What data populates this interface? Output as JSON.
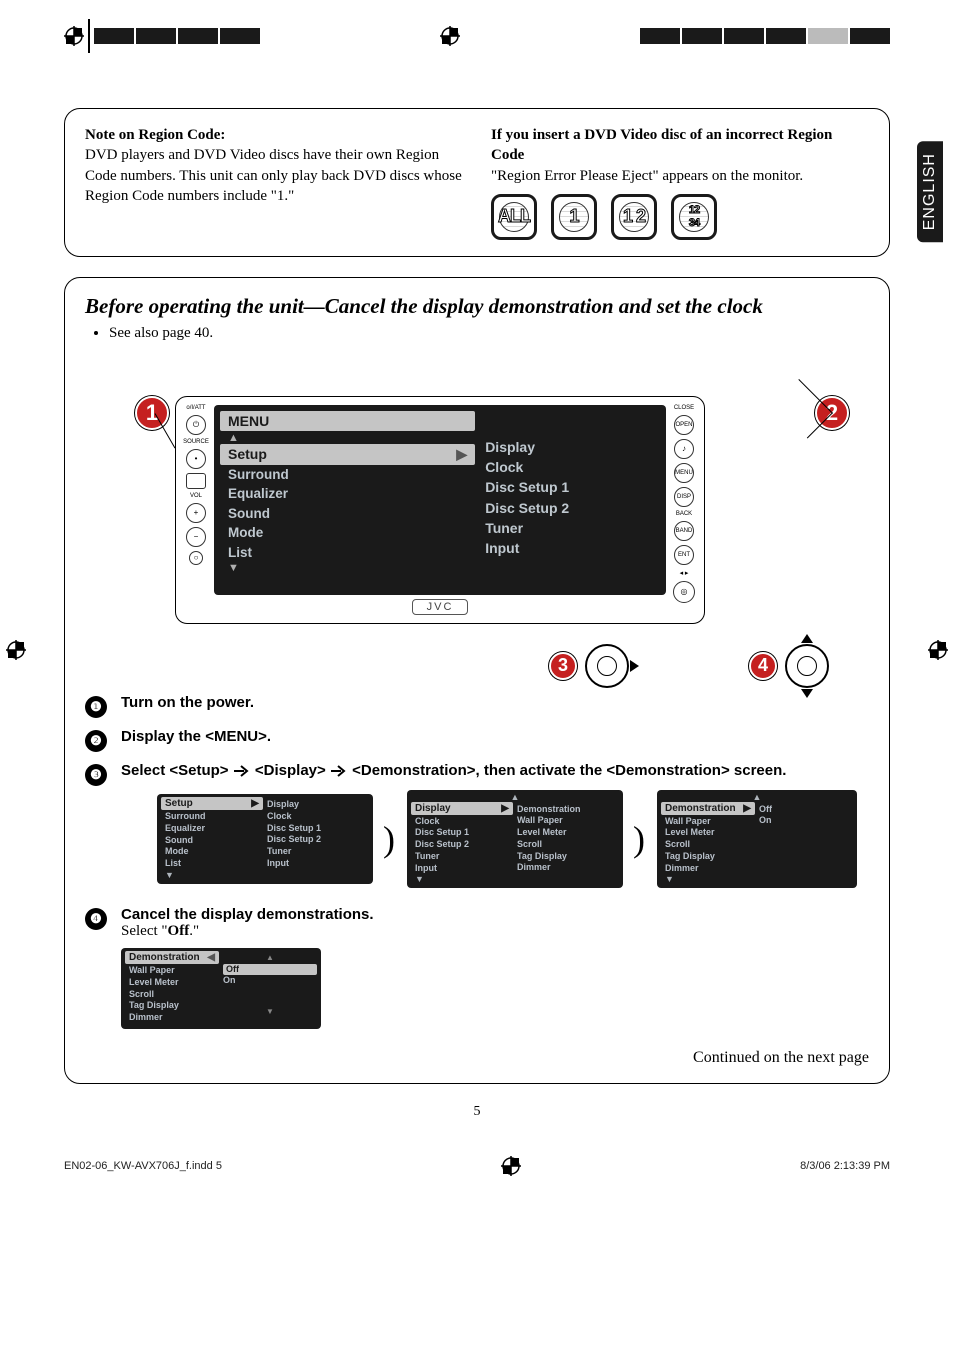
{
  "regionNote": {
    "title": "Note on Region Code:",
    "body": "DVD players and DVD Video discs have their own Region Code numbers. This unit can only play back DVD discs whose Region Code numbers include \"1.\"",
    "ifTitle": "If you insert a DVD Video disc of an incorrect Region Code",
    "ifBody": "\"Region Error Please Eject\" appears on the monitor.",
    "icons": [
      "ALL",
      "1",
      "1 2",
      "1 2\n3 4"
    ]
  },
  "englishTab": "ENGLISH",
  "section": {
    "title": "Before operating the unit—Cancel the display demonstration and set the clock",
    "see": "See also page 40."
  },
  "device": {
    "menuTitle": "MENU",
    "selected": "Setup",
    "menuItems": [
      "Surround",
      "Equalizer",
      "Sound",
      "Mode",
      "List"
    ],
    "subItems": [
      "Display",
      "Clock",
      "Disc Setup 1",
      "Disc Setup 2",
      "Tuner",
      "Input"
    ],
    "brand": "JVC",
    "leftLabels": {
      "att": "o/I/ATT",
      "src": "SOURCE",
      "vol": "VOL"
    },
    "rightLabels": {
      "close": "CLOSE",
      "open": "OPEN",
      "menu": "MENU",
      "disp": "DISP",
      "back": "BACK",
      "band": "BAND",
      "ent": "ENT"
    }
  },
  "callouts": {
    "c1": "1",
    "c2": "2",
    "c3": "3",
    "c4": "4"
  },
  "steps": {
    "s1": "Turn on the power.",
    "s2": "Display the <MENU>.",
    "s3": "Select <Setup> ⇒ <Display> ⇒ <Demonstration>, then activate the <Demonstration> screen.",
    "s3_p1": "Select <Setup>",
    "s3_p2": "<Display>",
    "s3_p3": "<Demonstration>, then activate the <Demonstration> screen.",
    "s4_title": "Cancel the display demonstrations.",
    "s4_body_a": "Select \"",
    "s4_body_b": "Off",
    "s4_body_c": ".\""
  },
  "mini": {
    "scr1": {
      "head": "Setup",
      "left": [
        "Surround",
        "Equalizer",
        "Sound",
        "Mode",
        "List"
      ],
      "right": [
        "Display",
        "Clock",
        "Disc Setup 1",
        "Disc Setup 2",
        "Tuner",
        "Input"
      ]
    },
    "scr2": {
      "head": "Display",
      "left": [
        "Clock",
        "Disc Setup 1",
        "Disc Setup 2",
        "Tuner",
        "Input"
      ],
      "right": [
        "Demonstration",
        "Wall Paper",
        "Level Meter",
        "Scroll",
        "Tag Display",
        "Dimmer"
      ]
    },
    "scr3": {
      "head": "Demonstration",
      "left": [
        "Wall Paper",
        "Level Meter",
        "Scroll",
        "Tag Display",
        "Dimmer"
      ],
      "right": [
        "Off",
        "On"
      ]
    }
  },
  "continued": "Continued on the next page",
  "pageNum": "5",
  "footer": {
    "left": "EN02-06_KW-AVX706J_f.indd   5",
    "right": "8/3/06   2:13:39 PM"
  }
}
